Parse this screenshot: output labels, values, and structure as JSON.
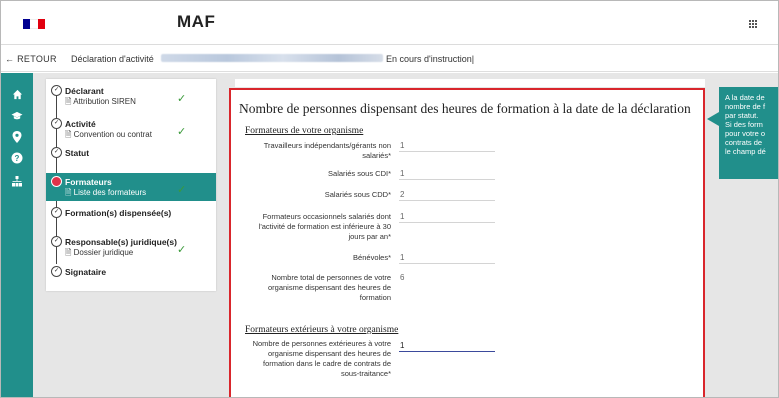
{
  "header": {
    "app_title": "MAF",
    "flag_colors": [
      "#000091",
      "#ffffff",
      "#e1000f"
    ],
    "apps_icon": "grid-icon"
  },
  "breadcrumb": {
    "back_label": "← RETOUR",
    "declaration_label": "Déclaration d'activité",
    "status_label": "En cours d'instruction|"
  },
  "rail": {
    "icons": [
      "home-icon",
      "graduation-cap-icon",
      "location-pin-icon",
      "help-icon",
      "org-chart-icon"
    ]
  },
  "stepper": {
    "steps": [
      {
        "title": "Déclarant",
        "sub": "Attribution SIREN",
        "done": true
      },
      {
        "title": "Activité",
        "sub": "Convention ou contrat",
        "done": true
      },
      {
        "title": "Statut",
        "sub": "",
        "done": false
      },
      {
        "title": "Formateurs",
        "sub": "Liste des formateurs",
        "done": true,
        "active": true
      },
      {
        "title": "Formation(s) dispensée(s)",
        "sub": "",
        "done": false
      },
      {
        "title": "Responsable(s) juridique(s)",
        "sub": "Dossier juridique",
        "done": true
      },
      {
        "title": "Signataire",
        "sub": "",
        "done": false
      }
    ]
  },
  "form": {
    "title": "Nombre de personnes dispensant des heures de formation à la date de la déclaration",
    "section_internal": "Formateurs de votre organisme",
    "section_external": "Formateurs extérieurs à votre organisme",
    "rows": [
      {
        "label": "Travailleurs indépendants/gérants non salariés*",
        "value": "1"
      },
      {
        "label": "Salariés sous CDI*",
        "value": "1"
      },
      {
        "label": "Salariés sous CDD*",
        "value": "2"
      },
      {
        "label": "Formateurs occasionnels salariés dont l'activité de formation est inférieure à 30 jours par an*",
        "value": "1"
      },
      {
        "label": "Bénévoles*",
        "value": "1"
      },
      {
        "label": "Nombre total de personnes de votre organisme dispensant des heures de formation",
        "value": "6"
      },
      {
        "label": "Nombre de personnes extérieures à votre organisme dispensant des heures de formation dans le cadre de contrats de sous-traitance*",
        "value": "1"
      }
    ]
  },
  "tooltip": {
    "lines": [
      "A la date de",
      "nombre de f",
      "par statut.",
      "Si des form",
      "pour votre o",
      "contrats de",
      "le champ dé"
    ]
  },
  "colors": {
    "accent_teal": "#218f8b",
    "error_red": "#d9262c",
    "check_green": "#3a9a3a"
  }
}
